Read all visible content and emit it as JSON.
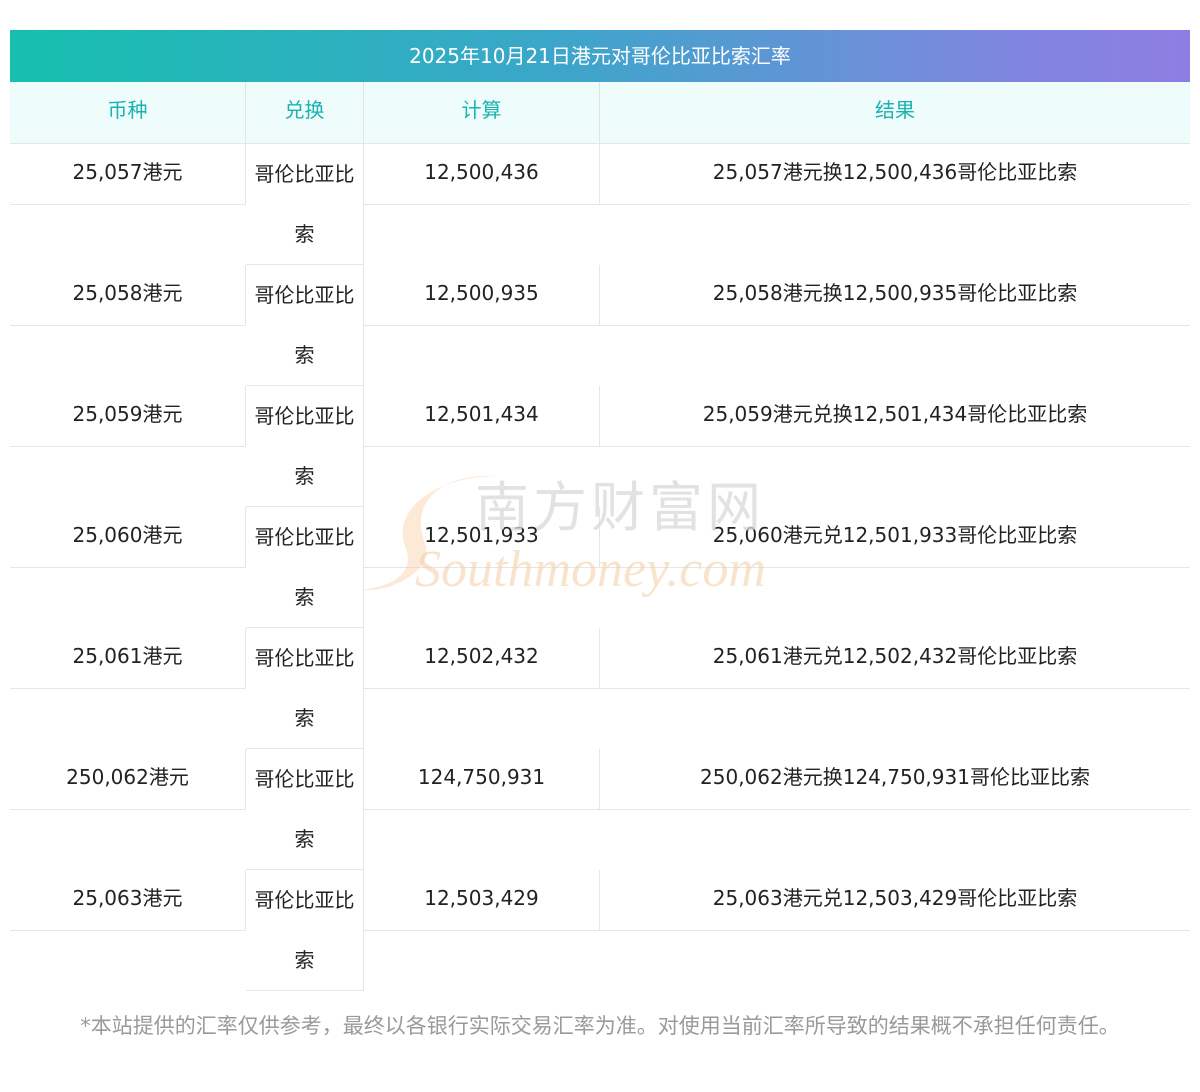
{
  "title": "2025年10月21日港元对哥伦比亚比索汇率",
  "headers": {
    "currency": "币种",
    "exchange": "兑换",
    "calc": "计算",
    "result": "结果"
  },
  "rows": [
    {
      "currency": "25,057港元",
      "exchange": "哥伦比亚比索",
      "calc": "12,500,436",
      "result": "25,057港元换12,500,436哥伦比亚比索"
    },
    {
      "currency": "25,058港元",
      "exchange": "哥伦比亚比索",
      "calc": "12,500,935",
      "result": "25,058港元换12,500,935哥伦比亚比索"
    },
    {
      "currency": "25,059港元",
      "exchange": "哥伦比亚比索",
      "calc": "12,501,434",
      "result": "25,059港元兑换12,501,434哥伦比亚比索"
    },
    {
      "currency": "25,060港元",
      "exchange": "哥伦比亚比索",
      "calc": "12,501,933",
      "result": "25,060港元兑12,501,933哥伦比亚比索"
    },
    {
      "currency": "25,061港元",
      "exchange": "哥伦比亚比索",
      "calc": "12,502,432",
      "result": "25,061港元兑12,502,432哥伦比亚比索"
    },
    {
      "currency": "250,062港元",
      "exchange": "哥伦比亚比索",
      "calc": "124,750,931",
      "result": "250,062港元换124,750,931哥伦比亚比索"
    },
    {
      "currency": "25,063港元",
      "exchange": "哥伦比亚比索",
      "calc": "12,503,429",
      "result": "25,063港元兑12,503,429哥伦比亚比索"
    }
  ],
  "watermark": {
    "cn": "南方财富网",
    "en": "Southmoney.com"
  },
  "footnote": "*本站提供的汇率仅供参考，最终以各银行实际交易汇率为准。对使用当前汇率所导致的结果概不承担任何责任。",
  "colors": {
    "header_text": "#1ab3b0",
    "header_bg": "#effcfc",
    "title_gradient_start": "#16bfae",
    "title_gradient_end": "#8e7ee3"
  }
}
